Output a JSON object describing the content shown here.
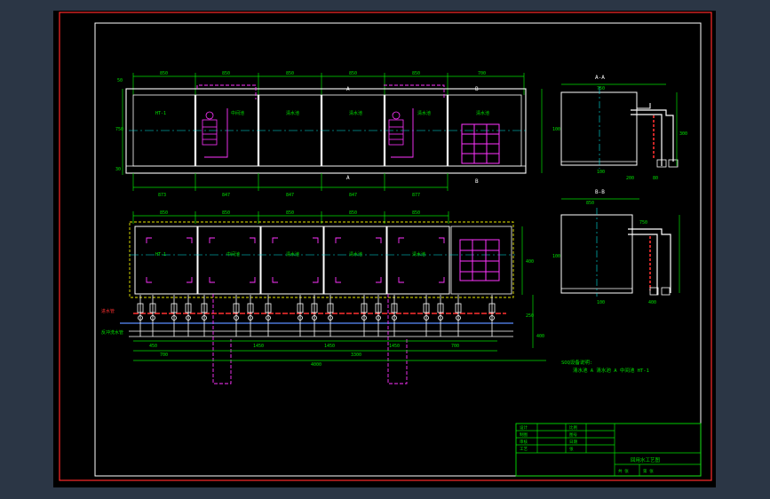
{
  "colors": {
    "background": "#2b3645",
    "sheet": "#000000",
    "border_outer": "#ff2a2a",
    "border_inner": "#ffffff",
    "line_green": "#00e000",
    "line_white": "#ffffff",
    "line_yellow": "#e8e800",
    "line_magenta": "#ff33ff",
    "line_cyan": "#00e5e5",
    "pipe_red": "#ff3030",
    "pipe_blue": "#5a8cff"
  },
  "plan_top": {
    "dims_top": [
      "850",
      "850",
      "850",
      "850",
      "850",
      "700"
    ],
    "dims_bottom": [
      "873",
      "847",
      "847",
      "847",
      "877"
    ],
    "dim_left": [
      "50",
      "750",
      "30"
    ],
    "cells": [
      "HT-1",
      "中间池",
      "清水池",
      "清水池",
      "清水池",
      "清水池"
    ],
    "markers": {
      "a_top": "A",
      "a_bottom": "A",
      "b_top": "B",
      "b_bottom": "B"
    }
  },
  "plan_bottom": {
    "dims_top": [
      "850",
      "850",
      "850",
      "850",
      "850"
    ],
    "dims_bottom": [
      "450",
      "1450",
      "1450",
      "1450",
      "700"
    ],
    "dim_total": "4000",
    "dim_sub": "3300",
    "dim_first": "700",
    "dim_right": [
      "400",
      "250",
      "400"
    ],
    "cells": [
      "HT-1",
      "中间池",
      "清水池",
      "清水池",
      "清水池"
    ],
    "pipe_labels": [
      "进水管",
      "反冲洗水管"
    ]
  },
  "section_aa": {
    "title": "A-A",
    "dims": [
      "100",
      "750",
      "100",
      "200",
      "80",
      "300"
    ]
  },
  "section_bb": {
    "title": "B-B",
    "dims": [
      "850",
      "100",
      "750",
      "100",
      "400"
    ]
  },
  "notes": {
    "title": "SOQ设备说明:",
    "line1": "清水池 A 清水池 A 中间池 HT-1"
  },
  "title_block": {
    "rows": [
      "设计",
      "制图",
      "审核",
      "工艺"
    ],
    "mid": [
      "比例",
      "图号",
      "日期",
      "张"
    ],
    "drawing_title": "回用水工艺图",
    "footer": [
      "共 张",
      "第 张"
    ]
  }
}
